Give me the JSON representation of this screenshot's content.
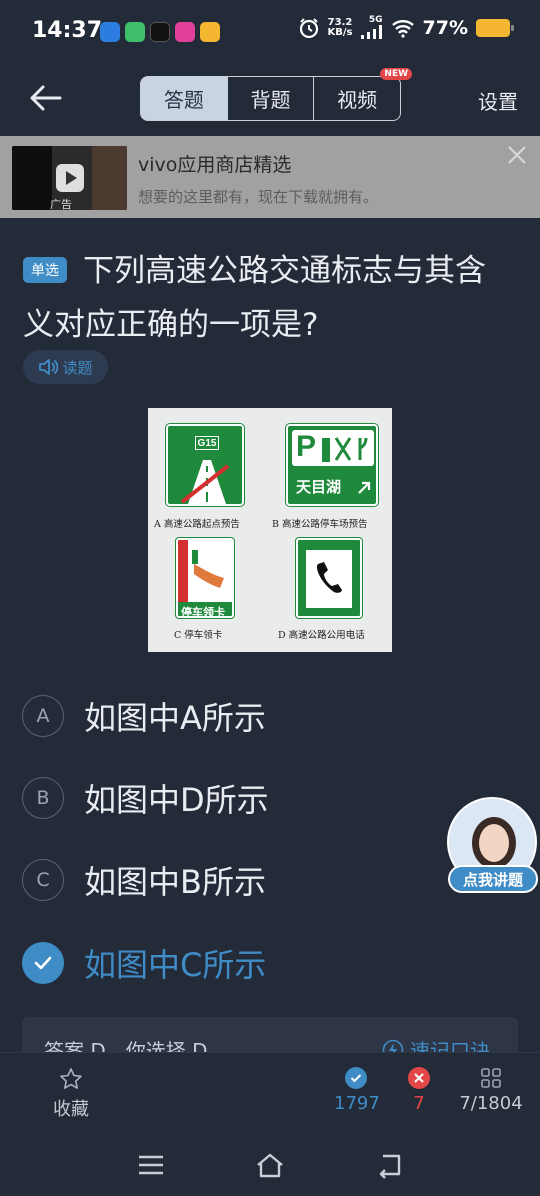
{
  "status": {
    "time": "14:37",
    "net_speed_value": "73.2",
    "net_speed_unit": "KB/s",
    "network": "5G",
    "battery": "77%"
  },
  "nav": {
    "tabs": [
      {
        "label": "答题",
        "active": true
      },
      {
        "label": "背题",
        "active": false
      },
      {
        "label": "视频",
        "active": false
      }
    ],
    "new_badge": "NEW",
    "settings_label": "设置"
  },
  "ad": {
    "title": "vivo应用商店精选",
    "subtitle": "想要的这里都有，现在下载就拥有。",
    "tag": "广告"
  },
  "question": {
    "type": "单选",
    "text": "下列高速公路交通标志与其含义对应正确的一项是?",
    "read_label": "读题",
    "figure": {
      "sign_a_code": "G15",
      "sign_b_text": "天目湖",
      "sign_b_pictograms": "P",
      "sign_c_text": "停车领卡",
      "caption_a": "A 高速公路起点预告",
      "caption_b": "B 高速公路停车场预告",
      "caption_c": "C 停车领卡",
      "caption_d": "D 高速公路公用电话"
    }
  },
  "options": [
    {
      "letter": "A",
      "text": "如图中A所示",
      "selected": false
    },
    {
      "letter": "B",
      "text": "如图中D所示",
      "selected": false
    },
    {
      "letter": "C",
      "text": "如图中B所示",
      "selected": false
    },
    {
      "letter": "D",
      "text": "如图中C所示",
      "selected": true
    }
  ],
  "ai_assistant": {
    "label": "点我讲题"
  },
  "answer": {
    "text": "答案 D，你选择 D",
    "memo_label": "速记口诀"
  },
  "bottom": {
    "favorite_label": "收藏",
    "correct_count": "1797",
    "wrong_count": "7",
    "progress": "7/1804"
  },
  "colors": {
    "background": "#232a38",
    "accent": "#3f8cc6",
    "wrong": "#e24747",
    "sign_green": "#1f8a3c"
  }
}
